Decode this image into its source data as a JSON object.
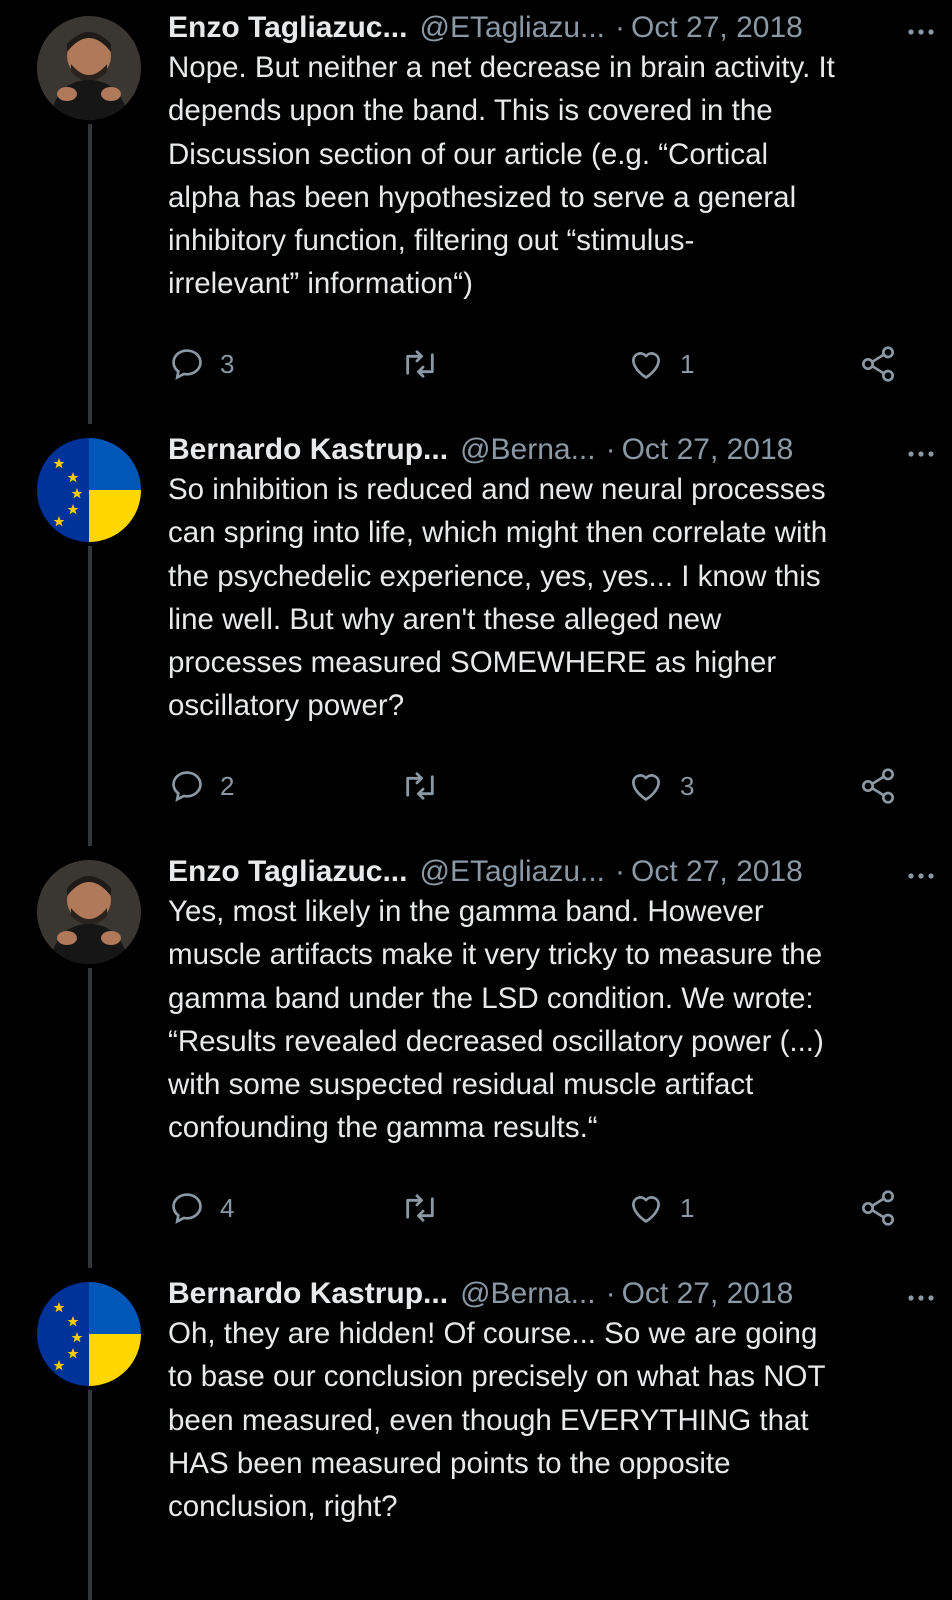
{
  "tweets": [
    {
      "name": "Enzo Tagliazuc...",
      "handle": "@ETagliazu...",
      "separator": "·",
      "date": "Oct 27, 2018",
      "avatar": "person-photo",
      "text": "Nope. But neither a net decrease in brain activity. It\ndepends upon the band. This is covered in the\nDiscussion section of our article (e.g. “Cortical\nalpha has been hypothesized to serve a general\ninhibitory function, filtering out “stimulus-\nirrelevant” information“)",
      "replies": "3",
      "retweets": "",
      "likes": "1"
    },
    {
      "name": "Bernardo Kastrup...",
      "handle": "@Berna...",
      "separator": "·",
      "date": "Oct 27, 2018",
      "avatar": "eu-ukraine-flag",
      "text": "So inhibition is reduced and new neural processes\ncan spring into life, which might then correlate with\nthe psychedelic experience, yes, yes... I know this\nline well. But why aren't these alleged new\nprocesses measured SOMEWHERE as higher\noscillatory power?",
      "replies": "2",
      "retweets": "",
      "likes": "3"
    },
    {
      "name": "Enzo Tagliazuc...",
      "handle": "@ETagliazu...",
      "separator": "·",
      "date": "Oct 27, 2018",
      "avatar": "person-photo",
      "text": "Yes, most likely in the gamma band. However\nmuscle artifacts make it very tricky to measure the\ngamma band under the LSD condition. We wrote:\n“Results revealed decreased oscillatory power (...)\nwith some suspected residual muscle artifact\nconfounding the gamma results.“",
      "replies": "4",
      "retweets": "",
      "likes": "1"
    },
    {
      "name": "Bernardo Kastrup...",
      "handle": "@Berna...",
      "separator": "·",
      "date": "Oct 27, 2018",
      "avatar": "eu-ukraine-flag",
      "text": "Oh, they are hidden! Of course... So we are going\nto base our conclusion precisely on what has NOT\nbeen measured, even though EVERYTHING that\nHAS been measured points to the opposite\nconclusion, right?",
      "replies": "",
      "retweets": "",
      "likes": ""
    }
  ],
  "colors": {
    "background": "#000000",
    "text": "#e7e9ea",
    "secondary": "#8b98a5",
    "thread_line": "#333639",
    "flag_blue": "#0057b8",
    "flag_yellow": "#ffd700",
    "eu_blue": "#003399",
    "eu_star": "#ffcc00"
  }
}
